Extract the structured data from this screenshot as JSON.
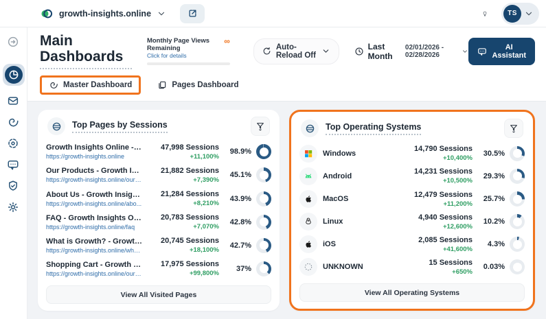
{
  "colors": {
    "accent": "#F0731D",
    "navy": "#17456E",
    "donut": "#2A5A84",
    "green": "#2F9E63",
    "link": "#2E6CA8"
  },
  "topbar": {
    "site": "growth-insights.online",
    "avatar_initials": "TS"
  },
  "sidebar": {
    "items": [
      {
        "icon": "collapse-arrow-icon",
        "style": "first dim"
      },
      {
        "icon": "analytics-pie-icon",
        "style": "active"
      },
      {
        "icon": "inbox-icon",
        "style": ""
      },
      {
        "icon": "spiral-icon",
        "style": ""
      },
      {
        "icon": "target-icon",
        "style": ""
      },
      {
        "icon": "chat-icon",
        "style": ""
      },
      {
        "icon": "shield-icon",
        "style": ""
      },
      {
        "icon": "settings-icon",
        "style": ""
      }
    ]
  },
  "header": {
    "title": "Main Dashboards",
    "quota": {
      "label": "Monthly Page Views Remaining",
      "link": "Click for details",
      "value": "∞"
    },
    "autoreload": "Auto-Reload Off",
    "period": "Last Month",
    "date_range": "02/01/2026 - 02/28/2026",
    "ai_button": "AI Assistant"
  },
  "tabs": [
    {
      "label": "Master Dashboard",
      "active": true
    },
    {
      "label": "Pages Dashboard",
      "active": false
    }
  ],
  "cards": [
    {
      "title": "Top Pages by Sessions",
      "footer": "View All Visited Pages",
      "rows": [
        {
          "title": "Growth Insights Online - Growth I...",
          "subtitle": "https://growth-insights.online",
          "sessions": "47,998 Sessions",
          "delta": "+11,100%",
          "percent_label": "98.9%",
          "percent": 98.9
        },
        {
          "title": "Our Products - Growth Insights O...",
          "subtitle": "https://growth-insights.online/our-...",
          "sessions": "21,882 Sessions",
          "delta": "+7,390%",
          "percent_label": "45.1%",
          "percent": 45.1
        },
        {
          "title": "About Us - Growth Insights Online",
          "subtitle": "https://growth-insights.online/abo...",
          "sessions": "21,284 Sessions",
          "delta": "+8,210%",
          "percent_label": "43.9%",
          "percent": 43.9
        },
        {
          "title": "FAQ - Growth Insights Online",
          "subtitle": "https://growth-insights.online/faq",
          "sessions": "20,783 Sessions",
          "delta": "+7,070%",
          "percent_label": "42.8%",
          "percent": 42.8
        },
        {
          "title": "What is Growth? - Growth Insight...",
          "subtitle": "https://growth-insights.online/wha...",
          "sessions": "20,745 Sessions",
          "delta": "+18,100%",
          "percent_label": "42.7%",
          "percent": 42.7
        },
        {
          "title": "Shopping Cart - Growth Insights ...",
          "subtitle": "https://growth-insights.online/our-...",
          "sessions": "17,975 Sessions",
          "delta": "+99,800%",
          "percent_label": "37%",
          "percent": 37
        }
      ]
    },
    {
      "title": "Top Operating Systems",
      "footer": "View All Operating Systems",
      "highlight": true,
      "rows": [
        {
          "icon": "windows-icon",
          "title": "Windows",
          "sessions": "14,790 Sessions",
          "delta": "+10,400%",
          "percent_label": "30.5%",
          "percent": 30.5
        },
        {
          "icon": "android-icon",
          "title": "Android",
          "sessions": "14,231 Sessions",
          "delta": "+10,500%",
          "percent_label": "29.3%",
          "percent": 29.3
        },
        {
          "icon": "apple-icon",
          "title": "MacOS",
          "sessions": "12,479 Sessions",
          "delta": "+11,200%",
          "percent_label": "25.7%",
          "percent": 25.7
        },
        {
          "icon": "linux-icon",
          "title": "Linux",
          "sessions": "4,940 Sessions",
          "delta": "+12,600%",
          "percent_label": "10.2%",
          "percent": 10.2
        },
        {
          "icon": "apple-icon",
          "title": "iOS",
          "sessions": "2,085 Sessions",
          "delta": "+41,600%",
          "percent_label": "4.3%",
          "percent": 4.3
        },
        {
          "icon": "unknown-icon",
          "title": "UNKNOWN",
          "sessions": "15 Sessions",
          "delta": "+650%",
          "percent_label": "0.03%",
          "percent": 0.03
        }
      ]
    }
  ]
}
